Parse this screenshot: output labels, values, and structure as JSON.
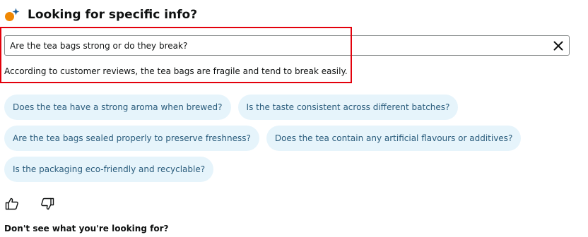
{
  "header": {
    "icon": "ai-spark-icon",
    "title": "Looking for specific info?"
  },
  "search": {
    "value": "Are the tea bags strong or do they break?",
    "clear_icon": "close-icon"
  },
  "answer": {
    "text": "According to customer reviews, the tea bags are fragile and tend to break easily."
  },
  "suggestions": [
    [
      "Does the tea have a strong aroma when brewed?",
      "Is the taste consistent across different batches?"
    ],
    [
      "Are the tea bags sealed properly to preserve freshness?",
      "Does the tea contain any artificial flavours or additives?"
    ],
    [
      "Is the packaging eco-friendly and recyclable?"
    ]
  ],
  "feedback": {
    "up_icon": "thumbs-up-icon",
    "down_icon": "thumbs-down-icon"
  },
  "footer": {
    "prompt": "Don't see what you're looking for?"
  },
  "colors": {
    "highlight": "#e3000b",
    "chip_bg": "#e6f4fb",
    "chip_text": "#2a5c7c",
    "accent_orange": "#f08804",
    "accent_blue": "#1c5d96"
  }
}
